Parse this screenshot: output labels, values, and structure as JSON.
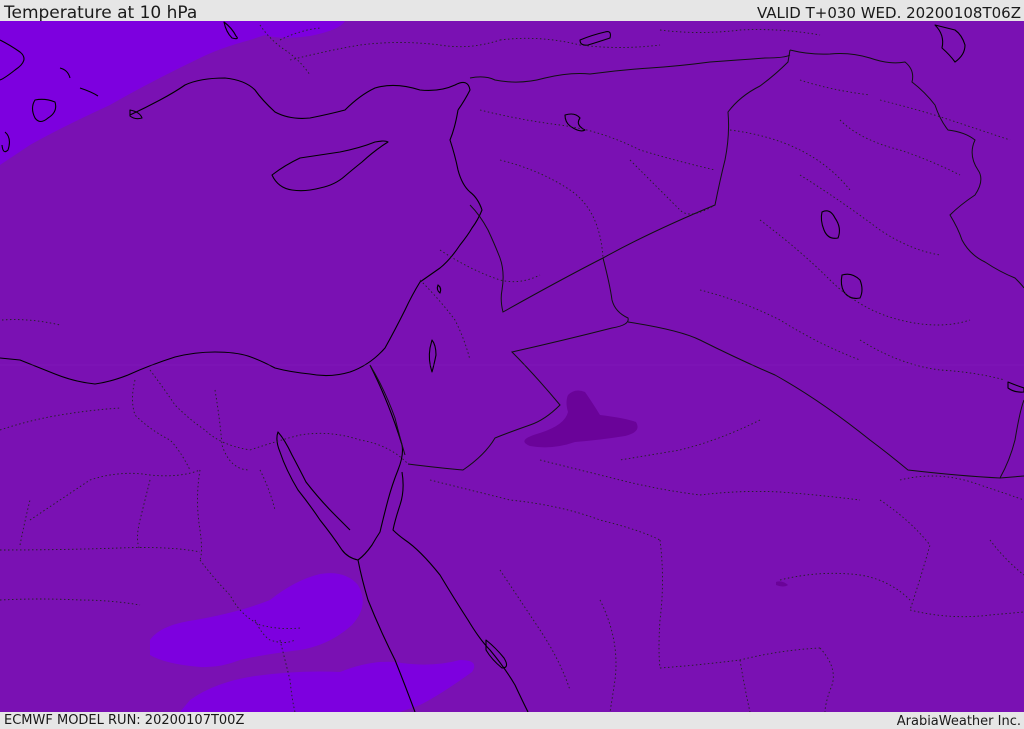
{
  "header": {
    "title": "Temperature at 10 hPa",
    "valid": "VALID T+030 WED. 20200108T06Z"
  },
  "footer": {
    "model_run": "ECMWF MODEL RUN: 20200107T00Z",
    "credit": "ArabiaWeather Inc."
  },
  "colors": {
    "base_fill": "#7a11b3",
    "warm_band": "#7d00df",
    "cold_patch": "#6a0399",
    "coast_line": "#000000",
    "border_line": "#222222"
  }
}
